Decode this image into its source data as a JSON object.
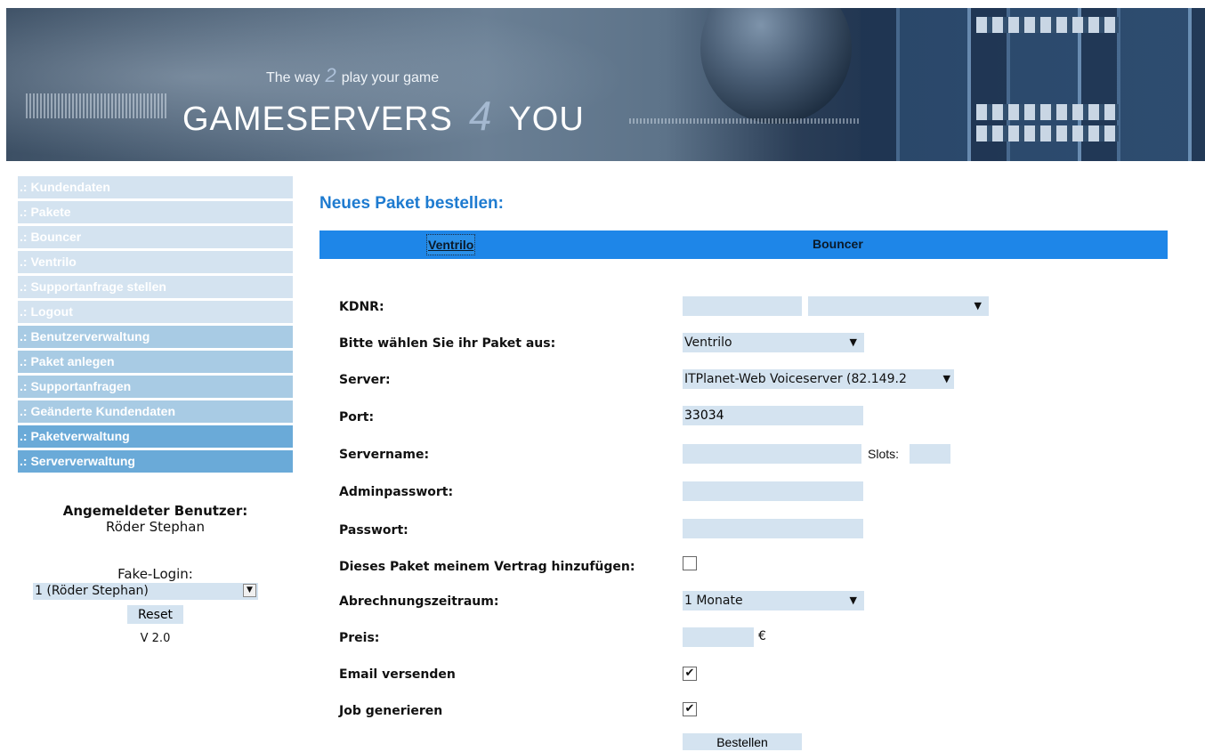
{
  "header": {
    "tagline_pre": "The way",
    "tagline_mid": "2",
    "tagline_post": "play your game",
    "logo_left": "GAMESERVERS",
    "logo_mid": "4",
    "logo_right": "YOU"
  },
  "sidebar": {
    "items": [
      ".: Kundendaten",
      ".: Pakete",
      ".: Bouncer",
      ".: Ventrilo",
      ".: Supportanfrage stellen",
      ".: Logout",
      ".: Benutzerverwaltung",
      ".: Paket anlegen",
      ".: Supportanfragen",
      ".: Geänderte Kundendaten",
      ".: Paketverwaltung",
      ".: Serververwaltung"
    ],
    "user_label": "Angemeldeter Benutzer:",
    "user_name": "Röder Stephan",
    "fake_login_label": "Fake-Login:",
    "fake_login_value": "1 (Röder Stephan)",
    "reset_label": "Reset",
    "version": "V 2.0"
  },
  "main": {
    "title": "Neues Paket bestellen:",
    "tabs": [
      "Ventrilo",
      "Bouncer"
    ],
    "form": {
      "kdnr_label": "KDNR:",
      "kdnr_value": "",
      "kdnr_select_value": "",
      "paket_label": "Bitte wählen Sie ihr Paket aus:",
      "paket_value": "Ventrilo",
      "server_label": "Server:",
      "server_value": "ITPlanet-Web Voiceserver (82.149.2",
      "port_label": "Port:",
      "port_value": "33034",
      "servername_label": "Servername:",
      "servername_value": "",
      "slots_label": "Slots:",
      "slots_value": "",
      "adminpw_label": "Adminpasswort:",
      "adminpw_value": "",
      "passwort_label": "Passwort:",
      "passwort_value": "",
      "vertrag_label": "Dieses Paket meinem Vertrag hinzufügen:",
      "vertrag_checked": false,
      "abrechnung_label": "Abrechnungszeitraum:",
      "abrechnung_value": "1 Monate",
      "preis_label": "Preis:",
      "preis_value": "",
      "currency": "€",
      "email_label": "Email versenden",
      "email_checked": true,
      "job_label": "Job generieren",
      "job_checked": true,
      "submit_label": "Bestellen"
    }
  }
}
